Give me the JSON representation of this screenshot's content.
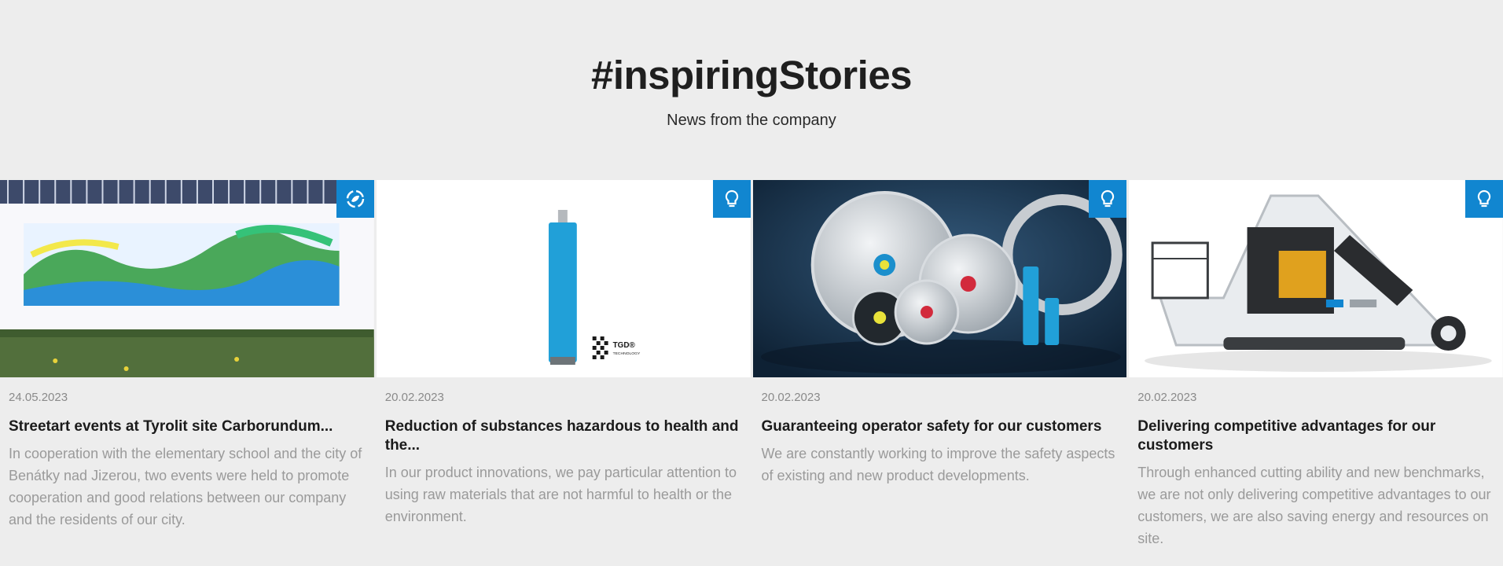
{
  "hero": {
    "title": "#inspiringStories",
    "subtitle": "News from the company"
  },
  "cards": [
    {
      "date": "24.05.2023",
      "title": "Streetart events at Tyrolit site Carborundum...",
      "text": "In cooperation with the elementary school and the city of Benátky nad Jizerou, two events were held to promote cooperation and good relations between our company and the residents of our city.",
      "icon": "sustainability-icon",
      "image": "streetart-mural-image"
    },
    {
      "date": "20.02.2023",
      "title": "Reduction of substances hazardous to health and the...",
      "text": "In our product innovations, we pay particular attention to using raw materials that are not harmful to health or the environment.",
      "icon": "lightbulb-icon",
      "image": "core-drill-image",
      "image_caption": "TGD®",
      "image_caption_small": "TECHNOLOGY"
    },
    {
      "date": "20.02.2023",
      "title": "Guaranteeing operator safety for our customers",
      "text": "We are constantly working to improve the safety aspects of existing and new product developments.",
      "icon": "lightbulb-icon",
      "image": "saw-blades-image"
    },
    {
      "date": "20.02.2023",
      "title": "Delivering competitive advantages for our customers",
      "text": "Through enhanced cutting ability and new benchmarks, we are not only delivering competitive advantages to our customers, we are also saving energy and resources on site.",
      "icon": "lightbulb-icon",
      "image": "road-machine-image"
    }
  ],
  "colors": {
    "accent": "#1186d0",
    "background": "#ededed",
    "muted_text": "#9a9a9a"
  }
}
